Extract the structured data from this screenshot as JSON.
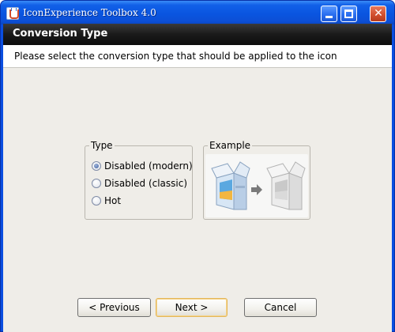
{
  "window": {
    "title": "IconExperience Toolbox 4.0",
    "controls": {
      "minimize": "minimize",
      "maximize": "maximize",
      "close": "close"
    }
  },
  "header": {
    "title": "Conversion Type",
    "subtitle": "Please select the conversion type that should be applied to the icon"
  },
  "type_group": {
    "legend": "Type",
    "options": [
      {
        "label": "Disabled (modern)",
        "checked": true
      },
      {
        "label": "Disabled (classic)",
        "checked": false
      },
      {
        "label": "Hot",
        "checked": false
      }
    ]
  },
  "example_group": {
    "legend": "Example",
    "icons": [
      "open-box-color-icon",
      "arrow-right-icon",
      "open-box-disabled-icon"
    ]
  },
  "buttons": {
    "previous": "< Previous",
    "next": "Next >",
    "cancel": "Cancel"
  },
  "colors": {
    "title_bar": "#0a55e0",
    "header_band": "#1a1a1a",
    "dialog_bg": "#efede8",
    "default_button_border": "#e4b75a"
  }
}
